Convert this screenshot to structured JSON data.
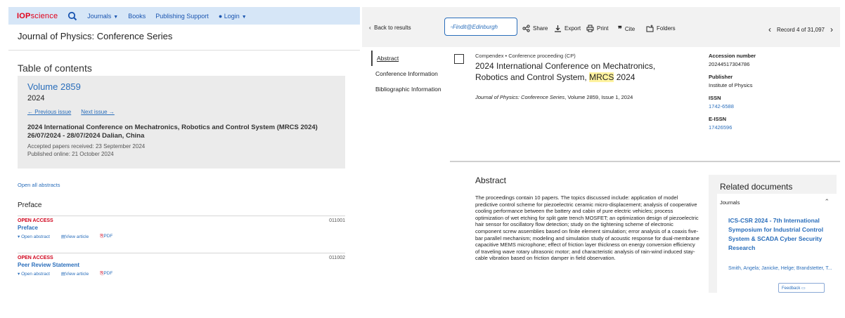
{
  "left": {
    "nav": {
      "logo_iop": "IOP",
      "logo_science": "science",
      "items": [
        "Journals",
        "Books",
        "Publishing Support",
        "Login"
      ]
    },
    "journal_title": "Journal of Physics: Conference Series",
    "toc_heading": "Table of contents",
    "volume": {
      "title": "Volume 2859",
      "year": "2024",
      "prev_issue": "← Previous issue",
      "next_issue": "Next issue →",
      "conference": "2024 International Conference on Mechatronics, Robotics and Control System (MRCS 2024) 26/07/2024 - 28/07/2024 Dalian, China",
      "accepted": "Accepted papers received: 23 September 2024",
      "published": "Published online: 21 October 2024"
    },
    "open_all": "Open all abstracts",
    "section_heading": "Preface",
    "articles": [
      {
        "access": "OPEN ACCESS",
        "number": "011001",
        "title": "Preface",
        "open_abstract": "Open abstract",
        "view_article": "View article",
        "pdf": "PDF"
      },
      {
        "access": "OPEN ACCESS",
        "number": "011002",
        "title": "Peer Review Statement",
        "open_abstract": "Open abstract",
        "view_article": "View article",
        "pdf": "PDF"
      }
    ]
  },
  "right": {
    "toolbar": {
      "back": "Back to results",
      "findit": "Findit@Edinburgh",
      "share": "Share",
      "export": "Export",
      "print": "Print",
      "cite": "Cite",
      "folders": "Folders",
      "record": "Record 4 of 31,097"
    },
    "sidebar": [
      "Abstract",
      "Conference Information",
      "Bibliographic Information"
    ],
    "record": {
      "meta": "Compendex • Conference proceeding (CP)",
      "title_a": "2024 International Conference on Mechatronics, Robotics and Control System, ",
      "title_hl": "MRCS",
      "title_b": " 2024",
      "source_journal": "Journal of Physics: Conference Series",
      "source_rest": ", Volume 2859, Issue 1, 2024"
    },
    "meta": {
      "accession_label": "Accession number",
      "accession_value": "20244517304786",
      "publisher_label": "Publisher",
      "publisher_value": "Institute of Physics",
      "issn_label": "ISSN",
      "issn_value": "1742-6588",
      "eissn_label": "E-ISSN",
      "eissn_value": "17426596"
    },
    "abstract_heading": "Abstract",
    "abstract_text": "The proceedings contain 10 papers. The topics discussed include: application of model predictive control scheme for piezoelectric ceramic micro-displacement; analysis of cooperative cooling performance between the battery and cabin of pure electric vehicles; process optimization of wet etching for split gate trench MOSFET; an optimization design of piezoelectric hair sensor for oscillatory flow detection; study on the tightening scheme of electronic component screw assemblies based on finite element simulation; error analysis of a coaxis five-bar parallel mechanism; modeling and simulation study of acoustic response for dual-membrane capacitive MEMS microphone; effect of friction layer thickness on energy conversion efficiency of traveling wave rotary ultrasonic motor; and characteristic analysis of rain-wind induced stay-cable vibration based on friction damper in field observation.",
    "related": {
      "heading": "Related documents",
      "category": "Journals",
      "title": "ICS-CSR 2024 - 7th International Symposium for Industrial Control System & SCADA Cyber Security Research",
      "authors": "Smith, Angela; Janicke, Helge; Brandstetter, T...",
      "feedback": "Feedback"
    }
  }
}
